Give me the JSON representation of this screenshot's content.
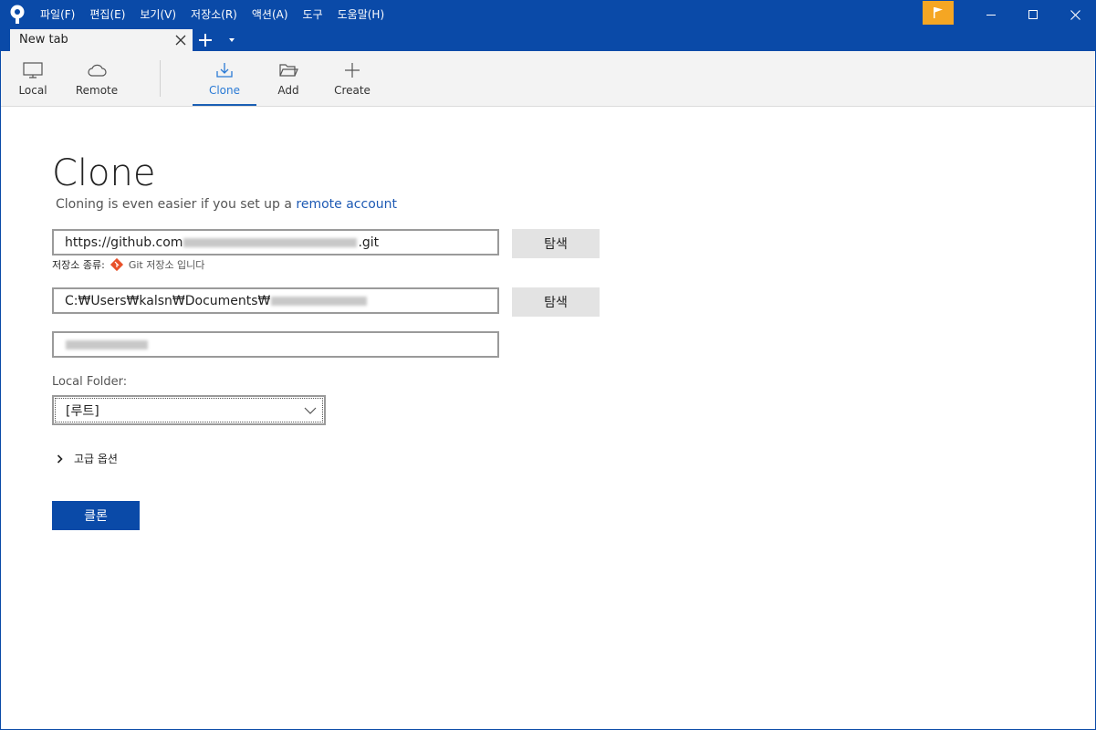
{
  "menubar": {
    "items": [
      "파일(F)",
      "편집(E)",
      "보기(V)",
      "저장소(R)",
      "액션(A)",
      "도구",
      "도움말(H)"
    ]
  },
  "tabs": [
    {
      "label": "New tab"
    }
  ],
  "toolbar": {
    "local_label": "Local",
    "remote_label": "Remote",
    "clone_label": "Clone",
    "add_label": "Add",
    "create_label": "Create",
    "active": "Clone"
  },
  "clone": {
    "title": "Clone",
    "subtitle_prefix": "Cloning is even easier if you set up a ",
    "subtitle_link": "remote account",
    "url_prefix": "https://github.com",
    "url_suffix": ".git",
    "browse_label": "탐색",
    "repo_type_label": "저장소 종류:",
    "repo_type_value": "Git 저장소 입니다",
    "path_prefix": "C:₩Users₩kalsn₩Documents₩",
    "local_folder_label": "Local Folder:",
    "local_folder_value": "[루트]",
    "advanced_label": "고급 옵션",
    "clone_button_label": "클론"
  },
  "colors": {
    "titlebar": "#0a4aa8",
    "accent": "#1e5ab4",
    "flag": "#f5a623",
    "git_icon": "#e8512a"
  }
}
